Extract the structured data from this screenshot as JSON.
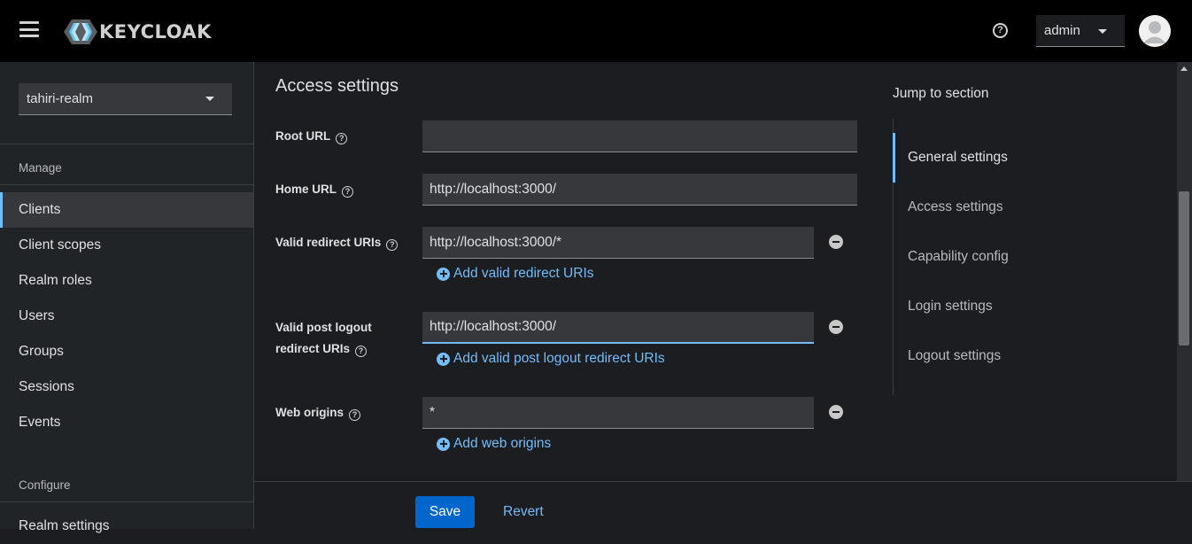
{
  "header": {
    "logo_text": "KEYCLOAK",
    "user_name": "admin"
  },
  "sidebar": {
    "realm": "tahiri-realm",
    "manage_label": "Manage",
    "manage_items": [
      {
        "label": "Clients",
        "active": true
      },
      {
        "label": "Client scopes"
      },
      {
        "label": "Realm roles"
      },
      {
        "label": "Users"
      },
      {
        "label": "Groups"
      },
      {
        "label": "Sessions"
      },
      {
        "label": "Events"
      }
    ],
    "configure_label": "Configure",
    "configure_items": [
      {
        "label": "Realm settings"
      }
    ]
  },
  "main": {
    "section_title": "Access settings",
    "fields": {
      "root_url": {
        "label": "Root URL",
        "value": ""
      },
      "home_url": {
        "label": "Home URL",
        "value": "http://localhost:3000/"
      },
      "valid_redirect": {
        "label": "Valid redirect URIs",
        "value": "http://localhost:3000/*",
        "add_label": "Add valid redirect URIs"
      },
      "post_logout": {
        "label_line1": "Valid post logout",
        "label_line2": "redirect URIs",
        "value": "http://localhost:3000/",
        "add_label": "Add valid post logout redirect URIs"
      },
      "web_origins": {
        "label": "Web origins",
        "value": "*",
        "add_label": "Add web origins"
      }
    }
  },
  "jump": {
    "title": "Jump to section",
    "items": [
      {
        "label": "General settings",
        "active": true
      },
      {
        "label": "Access settings"
      },
      {
        "label": "Capability config"
      },
      {
        "label": "Login settings"
      },
      {
        "label": "Logout settings"
      }
    ]
  },
  "footer": {
    "save_label": "Save",
    "revert_label": "Revert"
  },
  "colors": {
    "accent": "#73bcf7",
    "primary_button": "#0066cc",
    "header_bg": "#000000",
    "page_bg": "#1b1d21"
  }
}
